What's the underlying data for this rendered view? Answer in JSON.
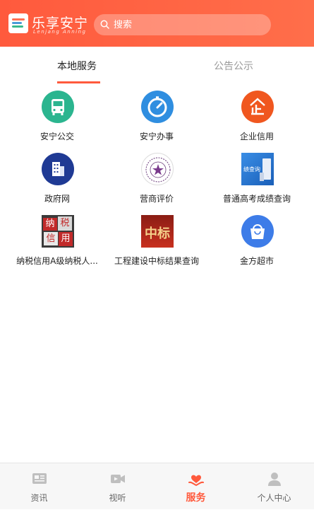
{
  "header": {
    "app_title": "乐享安宁",
    "app_subtitle": "Lenjang Anning",
    "search_placeholder": "搜索"
  },
  "tabs": [
    {
      "label": "本地服务",
      "active": true
    },
    {
      "label": "公告公示",
      "active": false
    }
  ],
  "services": [
    {
      "label": "安宁公交",
      "icon": "bus-icon",
      "color": "#2bb58f"
    },
    {
      "label": "安宁办事",
      "icon": "timer-icon",
      "color": "#2f8ee0"
    },
    {
      "label": "企业信用",
      "icon": "enterprise-icon",
      "color": "#f0571f"
    },
    {
      "label": "政府网",
      "icon": "building-icon",
      "color": "#1f3a94"
    },
    {
      "label": "营商评价",
      "icon": "seal-icon",
      "color": "#7a3a8c"
    },
    {
      "label": "普通高考成绩查询",
      "icon": "exam-score-image",
      "color": "#2a7fd6"
    },
    {
      "label": "纳税信用A级纳税人...",
      "icon": "tax-credit-image",
      "color": "#c22a2a"
    },
    {
      "label": "工程建设中标结果查询",
      "icon": "bid-result-image",
      "color": "#b8261e"
    },
    {
      "label": "金方超市",
      "icon": "shopping-bag-icon",
      "color": "#3d7ce8"
    }
  ],
  "tile_text": {
    "tax": [
      "纳",
      "税",
      "信",
      "用"
    ],
    "bid": "中标",
    "exam": "绩查询"
  },
  "bottom_nav": [
    {
      "label": "资讯",
      "icon": "news-icon",
      "active": false
    },
    {
      "label": "视听",
      "icon": "video-icon",
      "active": false
    },
    {
      "label": "服务",
      "icon": "service-icon",
      "active": true
    },
    {
      "label": "个人中心",
      "icon": "person-icon",
      "active": false
    }
  ],
  "colors": {
    "brand": "#ff5a3d",
    "active_nav": "#ff5a3d"
  }
}
